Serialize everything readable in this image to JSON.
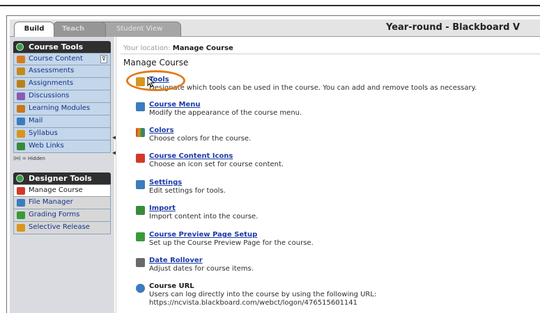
{
  "tabs": [
    {
      "label": "Build"
    },
    {
      "label": "Teach"
    },
    {
      "label": "Student View"
    }
  ],
  "course_title": "Year-round - Blackboard V",
  "course_tools": {
    "header": "Course Tools",
    "items": [
      {
        "label": "Course Content",
        "icon": "folder-icon",
        "color": "#d97a1f"
      },
      {
        "label": "Assessments",
        "icon": "assessment-icon",
        "color": "#c58a1c"
      },
      {
        "label": "Assignments",
        "icon": "assignment-icon",
        "color": "#b8821a"
      },
      {
        "label": "Discussions",
        "icon": "discussion-icon",
        "color": "#8a5bb0"
      },
      {
        "label": "Learning Modules",
        "icon": "module-icon",
        "color": "#c9781c"
      },
      {
        "label": "Mail",
        "icon": "mail-icon",
        "color": "#3b7bbf"
      },
      {
        "label": "Syllabus",
        "icon": "syllabus-icon",
        "color": "#d7961f"
      },
      {
        "label": "Web Links",
        "icon": "weblink-icon",
        "color": "#3a8a3a"
      }
    ],
    "hidden_note": "(H) = Hidden"
  },
  "designer_tools": {
    "header": "Designer Tools",
    "items": [
      {
        "label": "Manage Course",
        "icon": "manage-course-icon",
        "color": "#d13a2a"
      },
      {
        "label": "File Manager",
        "icon": "file-manager-icon",
        "color": "#3b7bbf"
      },
      {
        "label": "Grading Forms",
        "icon": "grading-forms-icon",
        "color": "#3a9a3a"
      },
      {
        "label": "Selective Release",
        "icon": "selective-release-icon",
        "color": "#d7961f"
      }
    ]
  },
  "main": {
    "location_label": "Your location:",
    "location_value": "Manage Course",
    "title": "Manage Course",
    "entries": [
      {
        "title": "Tools",
        "desc": "Designate which tools can be used in the course. You can add and remove tools as necessary.",
        "desc_shown": "Deˢᶦᵍⁿate which tools can be used in the course. You can add and remove tools as necessary.",
        "icon": "tools-icon",
        "color": "#d7961f",
        "link": true
      },
      {
        "title": "Course Menu",
        "desc": "Modify the appearance of the course menu.",
        "icon": "course-menu-icon",
        "color": "#3b7bbf",
        "link": true
      },
      {
        "title": "Colors",
        "desc": "Choose colors for the course.",
        "icon": "colors-icon",
        "color": "#c9781c",
        "link": true
      },
      {
        "title": "Course Content Icons",
        "desc": "Choose an icon set for course content.",
        "icon": "content-icons-icon",
        "color": "#d13a2a",
        "link": true
      },
      {
        "title": "Settings",
        "desc": "Edit settings for tools.",
        "icon": "settings-icon",
        "color": "#3b7bbf",
        "link": true
      },
      {
        "title": "Import",
        "desc": "Import content into the course.",
        "icon": "import-icon",
        "color": "#3a8a3a",
        "link": true
      },
      {
        "title": "Course Preview Page Setup",
        "desc": "Set up the Course Preview Page for the course.",
        "icon": "preview-page-icon",
        "color": "#3a9a3a",
        "link": true
      },
      {
        "title": "Date Rollover",
        "desc": "Adjust dates for course items.",
        "icon": "date-rollover-icon",
        "color": "#6a6a6a",
        "link": true
      },
      {
        "title": "Course URL",
        "desc": "Users can log directly into the course by using the following URL:",
        "desc2": "https://ncvista.blackboard.com/webct/logon/476515601141",
        "icon": "course-url-icon",
        "color": "#3b7bbf",
        "link": false
      }
    ]
  },
  "accent_color": "#e07b1c"
}
